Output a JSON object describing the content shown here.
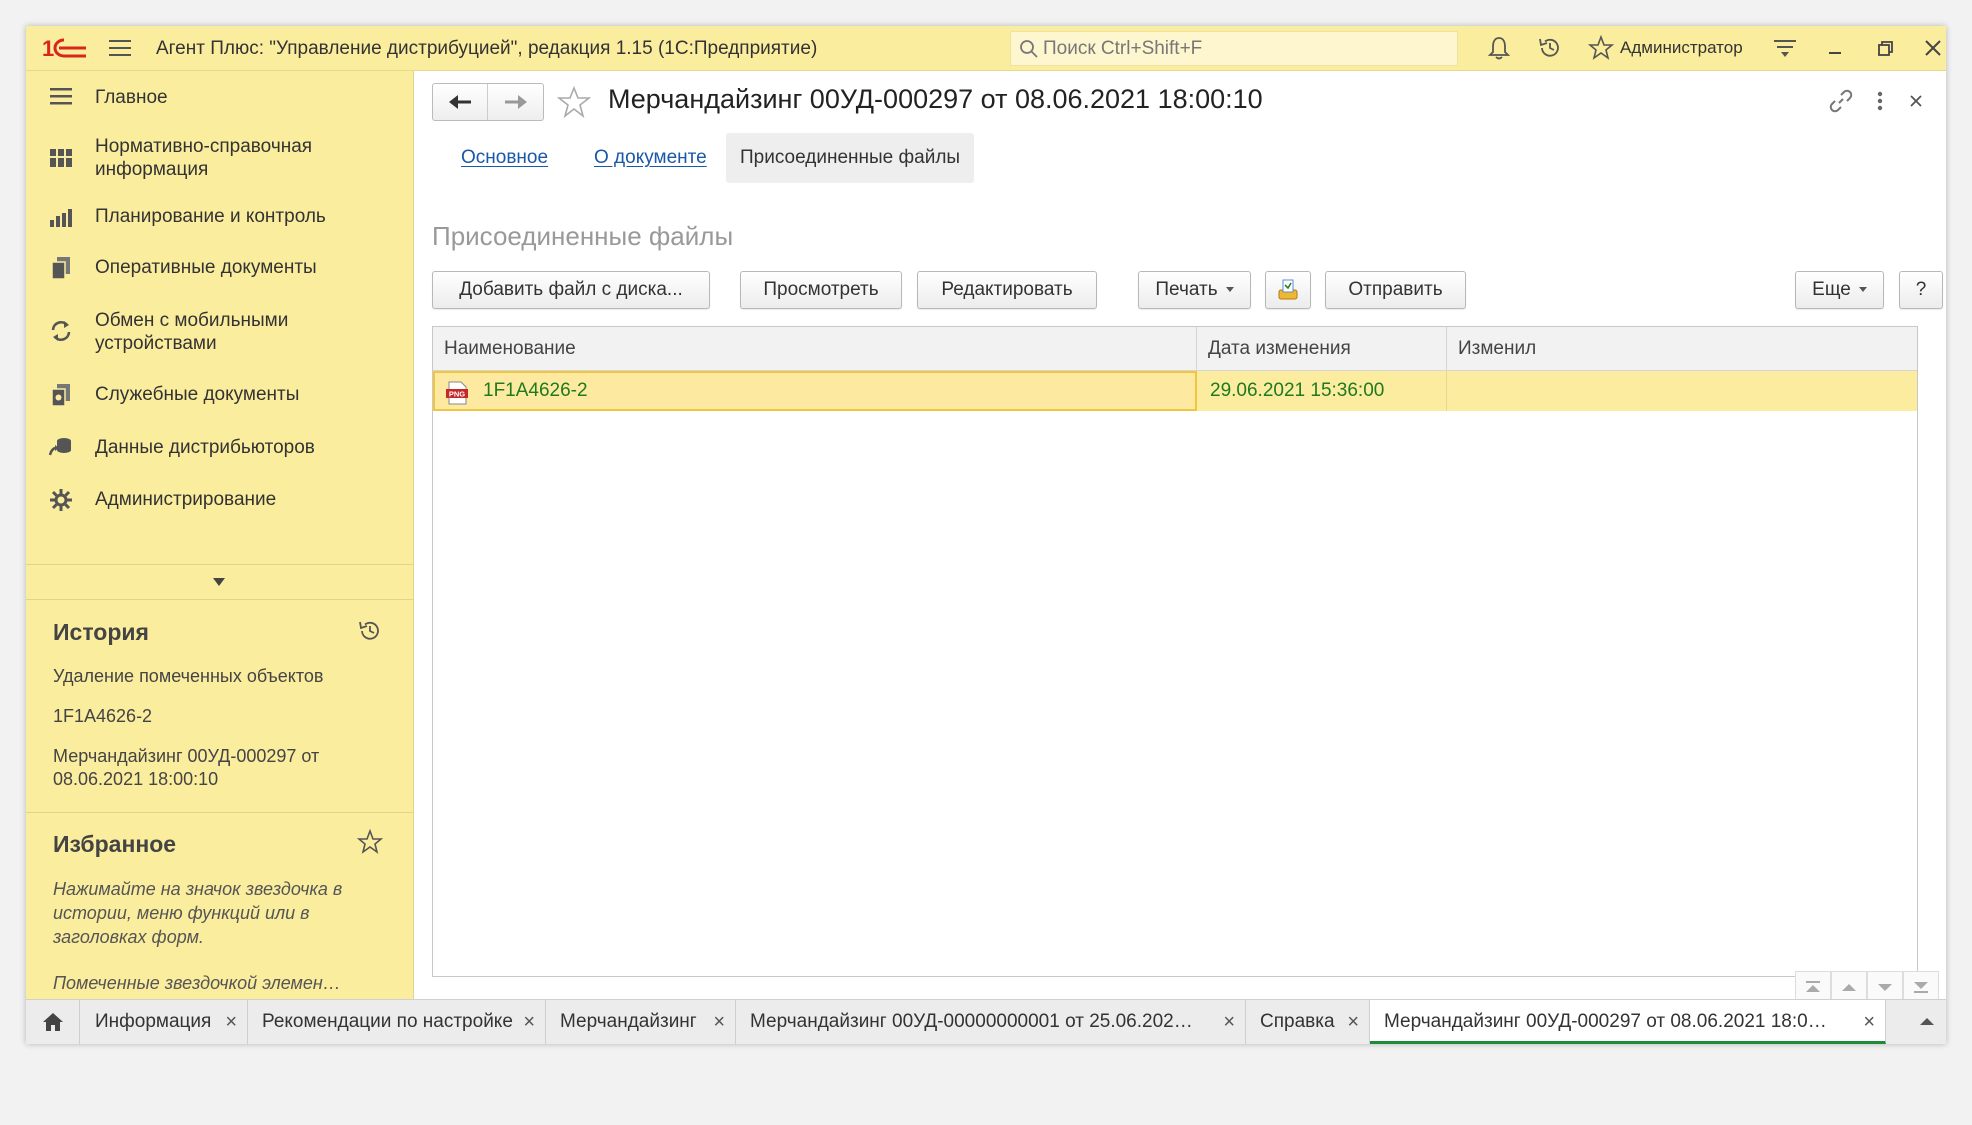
{
  "topbar": {
    "app_title": "Агент Плюс: \"Управление дистрибуцией\", редакция 1.15  (1С:Предприятие)",
    "search_placeholder": "Поиск Ctrl+Shift+F",
    "user_name": "Администратор",
    "icons": [
      "bell-icon",
      "history-icon",
      "star-icon",
      "settings-menu-icon",
      "minimize-icon",
      "restore-icon",
      "close-icon"
    ]
  },
  "sidebar": {
    "items": [
      {
        "label": "Главное",
        "icon": "menu-lines-icon"
      },
      {
        "label": "Нормативно-справочная информация",
        "icon": "reference-grid-icon"
      },
      {
        "label": "Планирование и контроль",
        "icon": "bar-chart-icon"
      },
      {
        "label": "Оперативные документы",
        "icon": "documents-icon"
      },
      {
        "label": "Обмен с мобильными устройствами",
        "icon": "sync-icon"
      },
      {
        "label": "Служебные документы",
        "icon": "service-docs-icon"
      },
      {
        "label": "Данные дистрибьюторов",
        "icon": "distributor-data-icon"
      },
      {
        "label": "Администрирование",
        "icon": "gear-icon"
      }
    ],
    "history": {
      "title": "История",
      "items": [
        "Удаление помеченных объектов",
        "1F1A4626-2",
        "Мерчандайзинг 00УД-000297 от 08.06.2021 18:00:10"
      ]
    },
    "favorites": {
      "title": "Избранное",
      "hint": "Нажимайте на значок звездочка в истории, меню функций или в заголовках форм.",
      "hint2": "Помеченные звездочкой элемен…"
    }
  },
  "document": {
    "title": "Мерчандайзинг 00УД-000297 от 08.06.2021 18:00:10",
    "tabs": [
      "Основное",
      "О документе",
      "Присоединенные файлы"
    ],
    "active_tab": "Присоединенные файлы",
    "section_title": "Присоединенные файлы",
    "toolbar": {
      "add_file": "Добавить файл с диска...",
      "view": "Просмотреть",
      "edit": "Редактировать",
      "print": "Печать",
      "send": "Отправить",
      "more": "Еще",
      "help": "?"
    },
    "table": {
      "columns": [
        "Наименование",
        "Дата изменения",
        "Изменил"
      ],
      "rows": [
        {
          "name": "1F1A4626-2",
          "file_type": "PNG",
          "date": "29.06.2021 15:36:00",
          "changed_by": ""
        }
      ]
    }
  },
  "window_tabs": [
    {
      "label": "Информация",
      "active": false
    },
    {
      "label": "Рекомендации по настройке",
      "active": false
    },
    {
      "label": "Мерчандайзинг",
      "active": false
    },
    {
      "label": "Мерчандайзинг 00УД-00000000001 от 25.06.202…",
      "active": false
    },
    {
      "label": "Справка",
      "active": false
    },
    {
      "label": "Мерчандайзинг 00УД-000297 от 08.06.2021 18:0…",
      "active": true
    }
  ],
  "colors": {
    "panel_yellow": "#fbed9e",
    "selection_yellow": "#fbeca0",
    "link_blue": "#1a58a8",
    "row_text_green": "#1f7a1f",
    "active_tab_underline": "#1e8a3a",
    "logo_red": "#d9261c"
  }
}
